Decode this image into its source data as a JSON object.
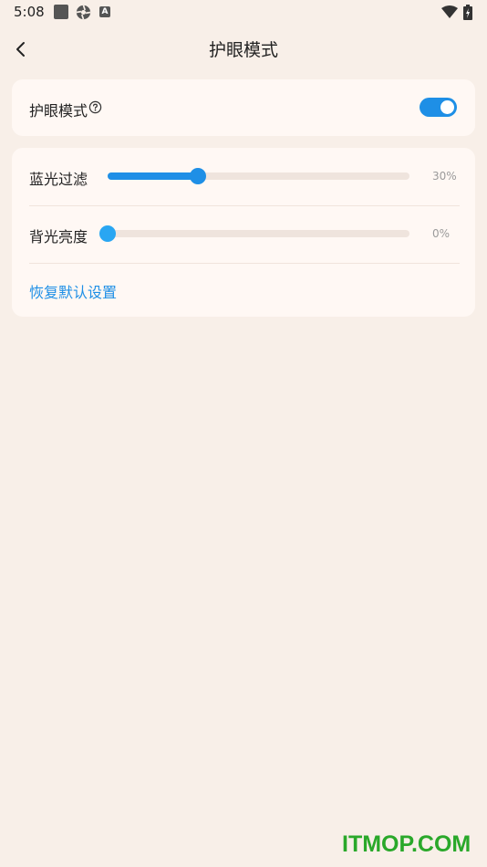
{
  "status_bar": {
    "time": "5:08",
    "a_label": "A"
  },
  "header": {
    "title": "护眼模式"
  },
  "eye_mode": {
    "label": "护眼模式",
    "enabled": true
  },
  "settings": {
    "blue_light": {
      "label": "蓝光过滤",
      "value_text": "30%",
      "value": 0.3
    },
    "backlight": {
      "label": "背光亮度",
      "value_text": "0%",
      "value": 0.0
    },
    "reset_label": "恢复默认设置"
  },
  "colors": {
    "accent": "#1e8fe6",
    "background": "#f8efe8",
    "card": "#fff8f4"
  },
  "watermark": "ITMOP.COM"
}
